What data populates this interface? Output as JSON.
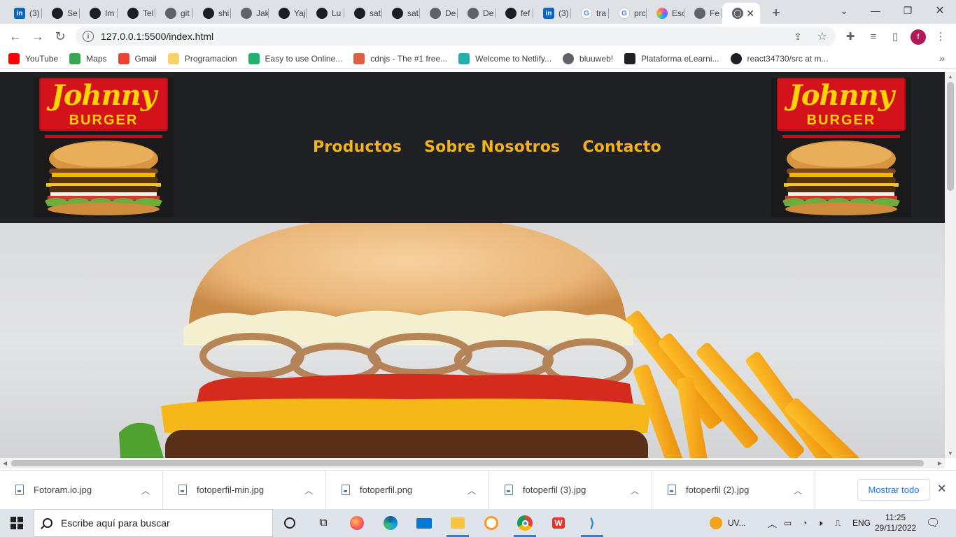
{
  "browser": {
    "tabs": [
      {
        "label": "(3)",
        "icon": "linkedin-icon"
      },
      {
        "label": "Se",
        "icon": "github-icon"
      },
      {
        "label": "Im",
        "icon": "github-icon"
      },
      {
        "label": "Tel",
        "icon": "github-icon"
      },
      {
        "label": "git",
        "icon": "globe-icon"
      },
      {
        "label": "shi",
        "icon": "github-icon"
      },
      {
        "label": "Jak",
        "icon": "globe-icon"
      },
      {
        "label": "Yaj",
        "icon": "github-icon"
      },
      {
        "label": "Lu",
        "icon": "github-icon"
      },
      {
        "label": "sat",
        "icon": "github-icon"
      },
      {
        "label": "sat",
        "icon": "github-icon"
      },
      {
        "label": "De",
        "icon": "globe-icon"
      },
      {
        "label": "De",
        "icon": "globe-icon"
      },
      {
        "label": "fef",
        "icon": "github-icon"
      },
      {
        "label": "(3)",
        "icon": "linkedin-icon"
      },
      {
        "label": "tra",
        "icon": "google-icon"
      },
      {
        "label": "prc",
        "icon": "google-icon"
      },
      {
        "label": "Esc",
        "icon": "ring-icon"
      },
      {
        "label": "Fe",
        "icon": "globe-icon"
      }
    ],
    "active_tab_icon": "globe-icon",
    "new_tab_symbol": "+",
    "url": "127.0.0.1:5500/index.html",
    "profile_initial": "f",
    "bookmarks": [
      {
        "label": "YouTube",
        "icon": "youtube-icon",
        "color": "#ff0000"
      },
      {
        "label": "Maps",
        "icon": "maps-icon",
        "color": "#34a853"
      },
      {
        "label": "Gmail",
        "icon": "gmail-icon",
        "color": "#ea4335"
      },
      {
        "label": "Programacion",
        "icon": "folder-icon",
        "color": "#f6d26b"
      },
      {
        "label": "Easy to use Online...",
        "icon": "s-icon",
        "color": "#1fb36b"
      },
      {
        "label": "cdnjs - The #1 free...",
        "icon": "code-icon",
        "color": "#e05d44"
      },
      {
        "label": "Welcome to Netlify...",
        "icon": "netlify-icon",
        "color": "#20b2aa"
      },
      {
        "label": "bluuweb!",
        "icon": "globe-icon",
        "color": "#5f6368"
      },
      {
        "label": "Plataforma eLearni...",
        "icon": "elearning-icon",
        "color": "#202124"
      },
      {
        "label": "react34730/src at m...",
        "icon": "github-icon",
        "color": "#1b1f23"
      }
    ]
  },
  "site": {
    "logo_line1": "Johnny",
    "logo_line2": "BURGER",
    "nav": [
      "Productos",
      "Sobre Nosotros",
      "Contacto"
    ],
    "accent_color": "#f4b31c",
    "header_bg": "#1f2124"
  },
  "downloads": {
    "files": [
      "Fotoram.io.jpg",
      "fotoperfil-min.jpg",
      "fotoperfil.png",
      "fotoperfil (3).jpg",
      "fotoperfil (2).jpg"
    ],
    "show_all": "Mostrar todo"
  },
  "taskbar": {
    "search_placeholder": "Escribe aquí para buscar",
    "tray_app": "UV...",
    "language": "ENG",
    "time": "11:25",
    "date": "29/11/2022"
  }
}
